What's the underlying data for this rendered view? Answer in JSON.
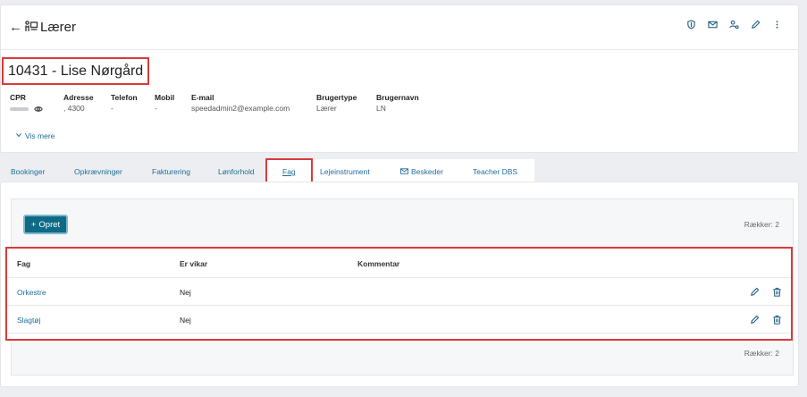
{
  "header": {
    "back_icon": "arrow-left-icon",
    "teacher_icon": "teacher-icon",
    "title": "Lærer",
    "actions": [
      {
        "name": "shield-icon"
      },
      {
        "name": "mail-icon"
      },
      {
        "name": "user-settings-icon"
      },
      {
        "name": "pencil-icon"
      },
      {
        "name": "kebab-menu-icon"
      }
    ]
  },
  "person": {
    "name": "10431 - Lise Nørgård"
  },
  "fields": {
    "cpr": {
      "label": "CPR",
      "value": ""
    },
    "adresse": {
      "label": "Adresse",
      "value": ", 4300"
    },
    "telefon": {
      "label": "Telefon",
      "value": "-"
    },
    "mobil": {
      "label": "Mobil",
      "value": "-"
    },
    "email": {
      "label": "E-mail",
      "value": "speedadmin2@example.com"
    },
    "brugertype": {
      "label": "Brugertype",
      "value": "Lærer"
    },
    "brugernavn": {
      "label": "Brugernavn",
      "value": "LN"
    }
  },
  "vis_mere": "Vis mere",
  "tabs": [
    {
      "label": "Bookinger"
    },
    {
      "label": "Opkrævninger"
    },
    {
      "label": "Fakturering"
    },
    {
      "label": "Lønforhold"
    },
    {
      "label": "Fag"
    },
    {
      "label": "Lejeinstrument"
    },
    {
      "label": "Beskeder"
    },
    {
      "label": "Teacher DBS"
    }
  ],
  "active_tab": "Fag",
  "toolbar": {
    "create_label": "Opret",
    "rows_count_top": "Rækker: 2",
    "rows_count_bottom": "Rækker: 2"
  },
  "table": {
    "columns": [
      "Fag",
      "Er vikar",
      "Kommentar"
    ],
    "rows": [
      {
        "fag": "Orkestre",
        "er_vikar": "Nej",
        "kommentar": ""
      },
      {
        "fag": "Slagtøj",
        "er_vikar": "Nej",
        "kommentar": ""
      }
    ]
  },
  "colors": {
    "primary": "#0e6a85",
    "link": "#1e6e9a",
    "highlight": "#d93a3a"
  }
}
